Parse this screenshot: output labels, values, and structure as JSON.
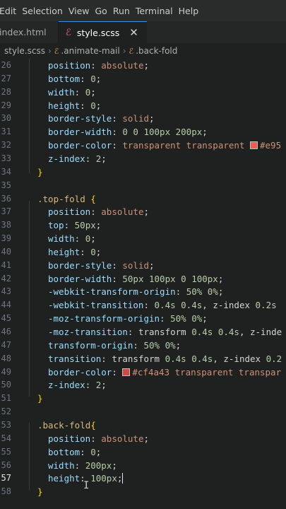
{
  "menu": [
    "Edit",
    "Selection",
    "View",
    "Go",
    "Run",
    "Terminal",
    "Help"
  ],
  "tabs": {
    "inactive": "index.html",
    "active": "style.scss",
    "close_glyph": "✕"
  },
  "breadcrumb": {
    "file": "style.scss",
    "parent": ".animate-mail",
    "current": ".back-fold"
  },
  "colors": {
    "swatch_e95": "#e95f55",
    "swatch_cf4a43": "#cf4a43"
  },
  "lines": [
    {
      "n": "26",
      "indent": 1,
      "tokens": [
        [
          "prop",
          "position"
        ],
        [
          "pn",
          ": "
        ],
        [
          "val",
          "absolute"
        ],
        [
          "pn",
          ";"
        ]
      ]
    },
    {
      "n": "27",
      "indent": 1,
      "tokens": [
        [
          "prop",
          "bottom"
        ],
        [
          "pn",
          ": "
        ],
        [
          "num",
          "0"
        ],
        [
          "pn",
          ";"
        ]
      ]
    },
    {
      "n": "28",
      "indent": 1,
      "tokens": [
        [
          "prop",
          "width"
        ],
        [
          "pn",
          ": "
        ],
        [
          "num",
          "0"
        ],
        [
          "pn",
          ";"
        ]
      ]
    },
    {
      "n": "29",
      "indent": 1,
      "tokens": [
        [
          "prop",
          "height"
        ],
        [
          "pn",
          ": "
        ],
        [
          "num",
          "0"
        ],
        [
          "pn",
          ";"
        ]
      ]
    },
    {
      "n": "30",
      "indent": 1,
      "tokens": [
        [
          "prop",
          "border-style"
        ],
        [
          "pn",
          ": "
        ],
        [
          "val",
          "solid"
        ],
        [
          "pn",
          ";"
        ]
      ]
    },
    {
      "n": "31",
      "indent": 1,
      "tokens": [
        [
          "prop",
          "border-width"
        ],
        [
          "pn",
          ": "
        ],
        [
          "num",
          "0 0 100px 200px"
        ],
        [
          "pn",
          ";"
        ]
      ]
    },
    {
      "n": "32",
      "indent": 1,
      "tokens": [
        [
          "prop",
          "border-color"
        ],
        [
          "pn",
          ": "
        ],
        [
          "val",
          "transparent transparent "
        ],
        [
          "swatch",
          "swatch_e95"
        ],
        [
          "hex",
          "#e95"
        ]
      ]
    },
    {
      "n": "33",
      "indent": 1,
      "tokens": [
        [
          "prop",
          "z-index"
        ],
        [
          "pn",
          ": "
        ],
        [
          "num",
          "2"
        ],
        [
          "pn",
          ";"
        ]
      ]
    },
    {
      "n": "34",
      "indent": 0,
      "tokens": [
        [
          "brace",
          "}"
        ]
      ]
    },
    {
      "n": "35",
      "indent": 0,
      "tokens": []
    },
    {
      "n": "36",
      "indent": 0,
      "tokens": [
        [
          "sel",
          ".top-fold"
        ],
        [
          "pn",
          " "
        ],
        [
          "brace",
          "{"
        ]
      ]
    },
    {
      "n": "37",
      "indent": 1,
      "tokens": [
        [
          "prop",
          "position"
        ],
        [
          "pn",
          ": "
        ],
        [
          "val",
          "absolute"
        ],
        [
          "pn",
          ";"
        ]
      ]
    },
    {
      "n": "38",
      "indent": 1,
      "tokens": [
        [
          "prop",
          "top"
        ],
        [
          "pn",
          ": "
        ],
        [
          "num",
          "50px"
        ],
        [
          "pn",
          ";"
        ]
      ]
    },
    {
      "n": "39",
      "indent": 1,
      "tokens": [
        [
          "prop",
          "width"
        ],
        [
          "pn",
          ": "
        ],
        [
          "num",
          "0"
        ],
        [
          "pn",
          ";"
        ]
      ]
    },
    {
      "n": "40",
      "indent": 1,
      "tokens": [
        [
          "prop",
          "height"
        ],
        [
          "pn",
          ": "
        ],
        [
          "num",
          "0"
        ],
        [
          "pn",
          ";"
        ]
      ]
    },
    {
      "n": "41",
      "indent": 1,
      "tokens": [
        [
          "prop",
          "border-style"
        ],
        [
          "pn",
          ": "
        ],
        [
          "val",
          "solid"
        ],
        [
          "pn",
          ";"
        ]
      ]
    },
    {
      "n": "42",
      "indent": 1,
      "tokens": [
        [
          "prop",
          "border-width"
        ],
        [
          "pn",
          ": "
        ],
        [
          "num",
          "50px 100px 0 100px"
        ],
        [
          "pn",
          ";"
        ]
      ]
    },
    {
      "n": "43",
      "indent": 1,
      "tokens": [
        [
          "prop",
          "-webkit-transform-origin"
        ],
        [
          "pn",
          ": "
        ],
        [
          "num",
          "50% 0%"
        ],
        [
          "pn",
          ";"
        ]
      ]
    },
    {
      "n": "44",
      "indent": 1,
      "tokens": [
        [
          "prop",
          "-webkit-transition"
        ],
        [
          "pn",
          ": "
        ],
        [
          "num",
          "0.4s 0.4s"
        ],
        [
          "pn",
          ", z-index "
        ],
        [
          "num",
          "0.2s"
        ]
      ]
    },
    {
      "n": "45",
      "indent": 1,
      "tokens": [
        [
          "prop",
          "-moz-transform-origin"
        ],
        [
          "pn",
          ": "
        ],
        [
          "num",
          "50% 0%"
        ],
        [
          "pn",
          ";"
        ]
      ]
    },
    {
      "n": "46",
      "indent": 1,
      "tokens": [
        [
          "prop",
          "-moz-transition"
        ],
        [
          "pn",
          ": transform "
        ],
        [
          "num",
          "0.4s 0.4s"
        ],
        [
          "pn",
          ", z-inde"
        ]
      ]
    },
    {
      "n": "47",
      "indent": 1,
      "tokens": [
        [
          "prop",
          "transform-origin"
        ],
        [
          "pn",
          ": "
        ],
        [
          "num",
          "50% 0%"
        ],
        [
          "pn",
          ";"
        ]
      ]
    },
    {
      "n": "48",
      "indent": 1,
      "tokens": [
        [
          "prop",
          "transition"
        ],
        [
          "pn",
          ": transform "
        ],
        [
          "num",
          "0.4s 0.4s"
        ],
        [
          "pn",
          ", z-index "
        ],
        [
          "num",
          "0.2"
        ]
      ]
    },
    {
      "n": "49",
      "indent": 1,
      "tokens": [
        [
          "prop",
          "border-color"
        ],
        [
          "pn",
          ": "
        ],
        [
          "swatch",
          "swatch_cf4a43"
        ],
        [
          "hex",
          "#cf4a43"
        ],
        [
          "val",
          " transparent transpar"
        ]
      ]
    },
    {
      "n": "50",
      "indent": 1,
      "tokens": [
        [
          "prop",
          "z-index"
        ],
        [
          "pn",
          ": "
        ],
        [
          "num",
          "2"
        ],
        [
          "pn",
          ";"
        ]
      ]
    },
    {
      "n": "51",
      "indent": 0,
      "tokens": [
        [
          "brace",
          "}"
        ]
      ]
    },
    {
      "n": "52",
      "indent": 0,
      "tokens": []
    },
    {
      "n": "53",
      "indent": 0,
      "tokens": [
        [
          "sel",
          ".back-fold"
        ],
        [
          "brace",
          "{"
        ]
      ]
    },
    {
      "n": "54",
      "indent": 1,
      "tokens": [
        [
          "prop",
          "position"
        ],
        [
          "pn",
          ": "
        ],
        [
          "val",
          "absolute"
        ],
        [
          "pn",
          ";"
        ]
      ]
    },
    {
      "n": "55",
      "indent": 1,
      "tokens": [
        [
          "prop",
          "bottom"
        ],
        [
          "pn",
          ": "
        ],
        [
          "num",
          "0"
        ],
        [
          "pn",
          ";"
        ]
      ]
    },
    {
      "n": "56",
      "indent": 1,
      "tokens": [
        [
          "prop",
          "width"
        ],
        [
          "pn",
          ": "
        ],
        [
          "num",
          "200px"
        ],
        [
          "pn",
          ";"
        ]
      ]
    },
    {
      "n": "57",
      "indent": 1,
      "current": true,
      "tokens": [
        [
          "prop",
          "height"
        ],
        [
          "pn",
          ": "
        ],
        [
          "num",
          "100px"
        ],
        [
          "pn",
          ";"
        ],
        [
          "cursor",
          ""
        ]
      ]
    },
    {
      "n": "58",
      "indent": 0,
      "tokens": [
        [
          "brace",
          "}"
        ]
      ]
    }
  ]
}
